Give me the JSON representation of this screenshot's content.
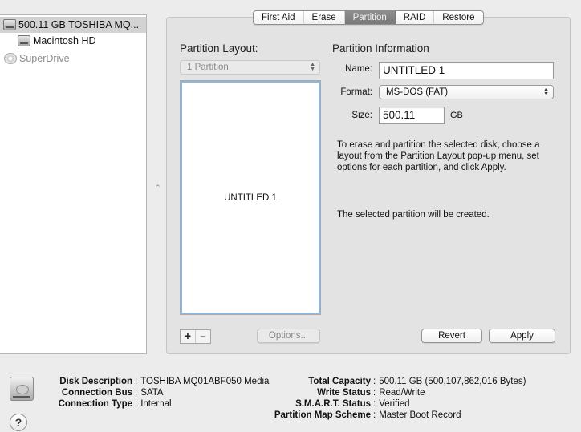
{
  "sidebar": {
    "items": [
      {
        "label": "500.11 GB TOSHIBA MQ...",
        "icon": "hard-disk-icon",
        "selected": true
      },
      {
        "label": "Macintosh HD",
        "icon": "hard-disk-icon",
        "selected": false
      },
      {
        "label": "SuperDrive",
        "icon": "optical-drive-icon",
        "selected": false
      }
    ]
  },
  "tabs": [
    {
      "label": "First Aid",
      "active": false
    },
    {
      "label": "Erase",
      "active": false
    },
    {
      "label": "Partition",
      "active": true
    },
    {
      "label": "RAID",
      "active": false
    },
    {
      "label": "Restore",
      "active": false
    }
  ],
  "partition_layout": {
    "title": "Partition Layout:",
    "selected": "1 Partition",
    "partitions": [
      "UNTITLED 1"
    ],
    "add_label": "+",
    "remove_label": "−",
    "options_label": "Options..."
  },
  "partition_info": {
    "title": "Partition Information",
    "name_label": "Name:",
    "name_value": "UNTITLED 1",
    "format_label": "Format:",
    "format_value": "MS-DOS (FAT)",
    "size_label": "Size:",
    "size_value": "500.11",
    "size_unit": "GB",
    "description": "To erase and partition the selected disk, choose a layout from the Partition Layout pop-up menu, set options for each partition, and click Apply.",
    "status": "The selected partition will be created."
  },
  "buttons": {
    "revert": "Revert",
    "apply": "Apply",
    "help": "?"
  },
  "disk_info": {
    "left": [
      {
        "key": "Disk Description",
        "value": "TOSHIBA MQ01ABF050 Media"
      },
      {
        "key": "Connection Bus",
        "value": "SATA"
      },
      {
        "key": "Connection Type",
        "value": "Internal"
      }
    ],
    "right": [
      {
        "key": "Total Capacity",
        "value": "500.11 GB (500,107,862,016 Bytes)"
      },
      {
        "key": "Write Status",
        "value": "Read/Write"
      },
      {
        "key": "S.M.A.R.T. Status",
        "value": "Verified"
      },
      {
        "key": "Partition Map Scheme",
        "value": "Master Boot Record"
      }
    ],
    "separator": ":"
  },
  "colors": {
    "active_tab": "#838383",
    "selection_border": "#8cb7e0"
  }
}
